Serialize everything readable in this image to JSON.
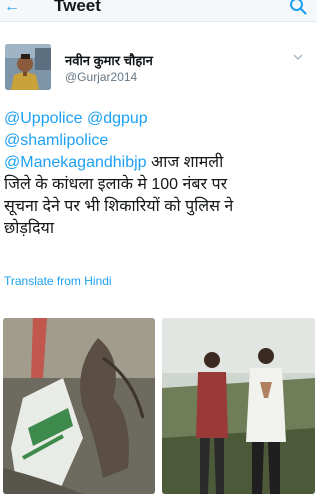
{
  "header": {
    "title": "Tweet"
  },
  "author": {
    "name": "नवीन कुमार चौहान",
    "handle": "@Gurjar2014"
  },
  "tweet": {
    "mention_1": "@Uppolice",
    "mention_2": "@dgpup",
    "mention_3": "@shamlipolice",
    "mention_4": "@Manekagandhibjp",
    "text_line_1": "आज शामली",
    "text_line_2": "जिले के कांधला इलाके मे 100 नंबर पर",
    "text_line_3": "सूचना देने पर भी शिकारियों को पुलिस ने",
    "text_line_4": "छोड़दिया"
  },
  "translate": {
    "label": "Translate from Hindi"
  },
  "icons": {
    "back": "back-arrow-icon",
    "search": "search-icon",
    "caret": "chevron-down-icon"
  },
  "colors": {
    "accent": "#1da1f2",
    "text": "#14171a",
    "muted": "#657786"
  }
}
